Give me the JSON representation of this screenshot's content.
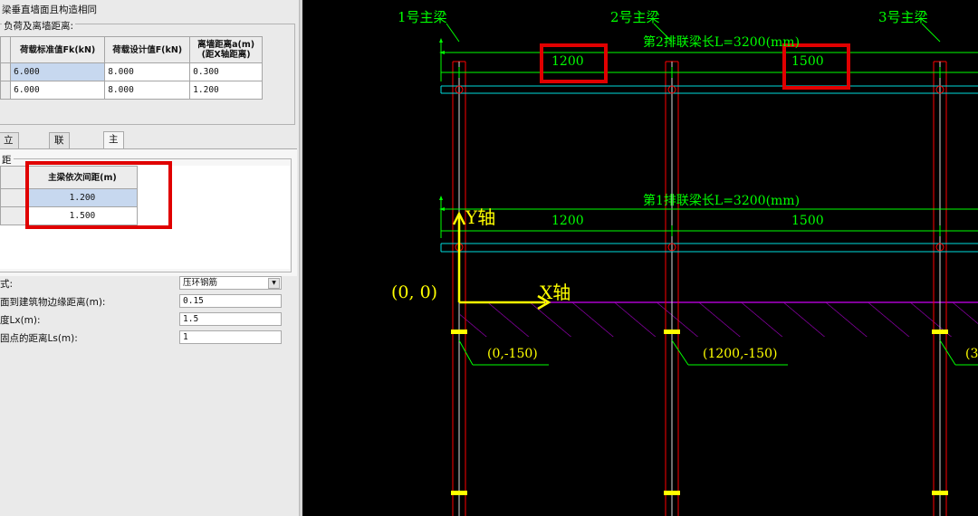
{
  "left_panel": {
    "header_option": "梁垂直墙面且构造相同",
    "load_group_title": "负荷及离墙距离:",
    "load_table": {
      "headers": [
        "荷载标准值Fk(kN)",
        "荷载设计值F(kN)",
        "离墙距离a(m)\n(距X轴距离)"
      ],
      "rows": [
        [
          "6.000",
          "8.000",
          "0.300"
        ],
        [
          "6.000",
          "8.000",
          "1.200"
        ]
      ]
    },
    "tabs": [
      "立杆纵距",
      "联梁定位",
      "主梁定位"
    ],
    "active_tab": "主梁定位",
    "spacing_group_title": "距",
    "spacing_table": {
      "header": "主梁依次间距(m)",
      "rows": [
        "1.200",
        "1.500"
      ]
    },
    "form": {
      "type_label": "式:",
      "type_value": "压环钢筋",
      "edge_label": "面到建筑物边缘距离(m):",
      "edge_value": "0.15",
      "lx_label": "度Lx(m):",
      "lx_value": "1.5",
      "ls_label": "固点的距离Ls(m):",
      "ls_value": "1"
    }
  },
  "cad": {
    "beam_labels": [
      "1号主梁",
      "2号主梁",
      "3号主梁"
    ],
    "tie_beam_2": "第2排联梁长L=3200(mm)",
    "tie_beam_1": "第1排联梁长L=3200(mm)",
    "dims_top": [
      "1200",
      "1500"
    ],
    "dims_mid": [
      "1200",
      "1500"
    ],
    "y_axis": "Y轴",
    "x_axis": "X轴",
    "origin": "(0, 0)",
    "coords": [
      "(0,-150)",
      "(1200,-150)",
      "(3"
    ]
  },
  "colors": {
    "cad_background": "#000000",
    "dimension_green": "#00ff00",
    "axis_yellow": "#ffff00",
    "hatch_magenta": "#aa00cc",
    "highlight_red": "#e00000",
    "beam_red": "#ff0000",
    "tie_cyan": "#00dddd"
  }
}
